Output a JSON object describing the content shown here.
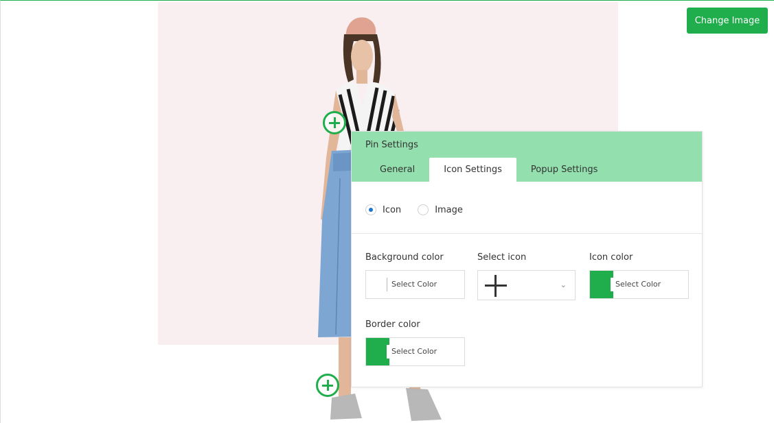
{
  "header": {
    "change_image_label": "Change Image"
  },
  "panel": {
    "title": "Pin Settings",
    "tabs": [
      {
        "label": "General"
      },
      {
        "label": "Icon Settings"
      },
      {
        "label": "Popup Settings"
      }
    ],
    "active_tab": "Icon Settings",
    "type_options": [
      {
        "label": "Icon",
        "checked": true
      },
      {
        "label": "Image",
        "checked": false
      }
    ],
    "fields": {
      "background_color": {
        "label": "Background color",
        "value_text": "Select Color"
      },
      "select_icon": {
        "label": "Select icon",
        "value_icon": "plus-icon"
      },
      "icon_color": {
        "label": "Icon color",
        "value_text": "Select Color",
        "swatch": "#1fae4b"
      },
      "border_color": {
        "label": "Border color",
        "value_text": "Select Color",
        "swatch": "#1fae4b"
      }
    }
  },
  "colors": {
    "accent": "#1fae4b",
    "panel_header": "#93dfad",
    "image_bg": "#f9eff0",
    "radio_checked": "#1976d2"
  },
  "icons": [
    "plus-circle-pin-icon",
    "plus-icon",
    "chevron-down-icon"
  ]
}
